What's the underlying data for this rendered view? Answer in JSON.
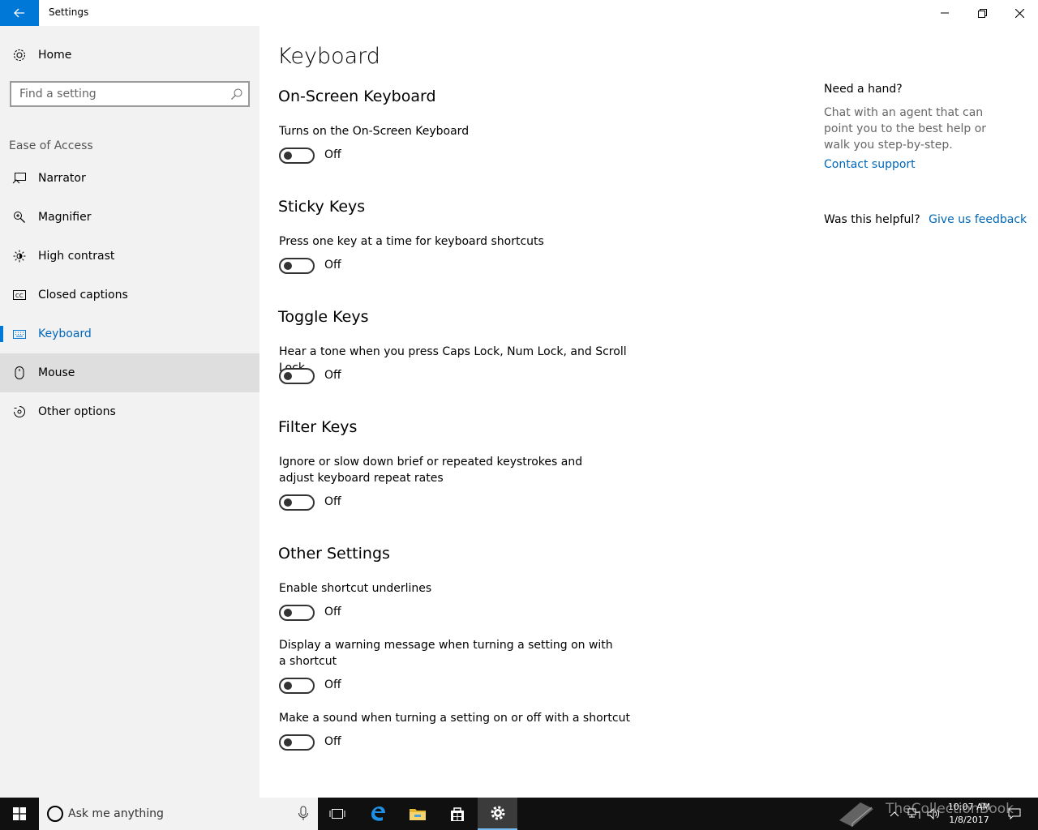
{
  "window": {
    "title": "Settings"
  },
  "sidebar": {
    "home_label": "Home",
    "search_placeholder": "Find a setting",
    "section_label": "Ease of Access",
    "items": [
      {
        "label": "Narrator",
        "icon": "narrator-icon"
      },
      {
        "label": "Magnifier",
        "icon": "magnifier-icon"
      },
      {
        "label": "High contrast",
        "icon": "brightness-icon"
      },
      {
        "label": "Closed captions",
        "icon": "cc-icon"
      },
      {
        "label": "Keyboard",
        "icon": "keyboard-icon",
        "active": true
      },
      {
        "label": "Mouse",
        "icon": "mouse-icon",
        "hover": true
      },
      {
        "label": "Other options",
        "icon": "other-options-icon"
      }
    ]
  },
  "main": {
    "title": "Keyboard",
    "groups": [
      {
        "title": "On-Screen Keyboard",
        "settings": [
          {
            "desc": "Turns on the On-Screen Keyboard",
            "state": "Off"
          }
        ]
      },
      {
        "title": "Sticky Keys",
        "settings": [
          {
            "desc": "Press one key at a time for keyboard shortcuts",
            "state": "Off"
          }
        ]
      },
      {
        "title": "Toggle Keys",
        "settings": [
          {
            "desc": "Hear a tone when you press Caps Lock, Num Lock, and Scroll Lock",
            "state": "Off"
          }
        ]
      },
      {
        "title": "Filter Keys",
        "settings": [
          {
            "desc": "Ignore or slow down brief or repeated keystrokes and adjust keyboard repeat rates",
            "state": "Off"
          }
        ]
      },
      {
        "title": "Other Settings",
        "settings": [
          {
            "desc": "Enable shortcut underlines",
            "state": "Off"
          },
          {
            "desc": "Display a warning message when turning a setting on with a shortcut",
            "state": "Off"
          },
          {
            "desc": "Make a sound when turning a setting on or off with a shortcut",
            "state": "Off"
          }
        ]
      }
    ]
  },
  "aside": {
    "title": "Need a hand?",
    "body": "Chat with an agent that can point you to the best help or walk you step-by-step.",
    "contact_link": "Contact support",
    "helpful_question": "Was this helpful?",
    "feedback_link": "Give us feedback"
  },
  "taskbar": {
    "search_placeholder": "Ask me anything",
    "time": "10:07 AM",
    "date": "1/8/2017",
    "watermark": "TheCollectionBook"
  },
  "colors": {
    "accent": "#0078d7",
    "link": "#0067b8",
    "sidebar_bg": "#f2f2f2",
    "taskbar_bg": "#101010"
  }
}
